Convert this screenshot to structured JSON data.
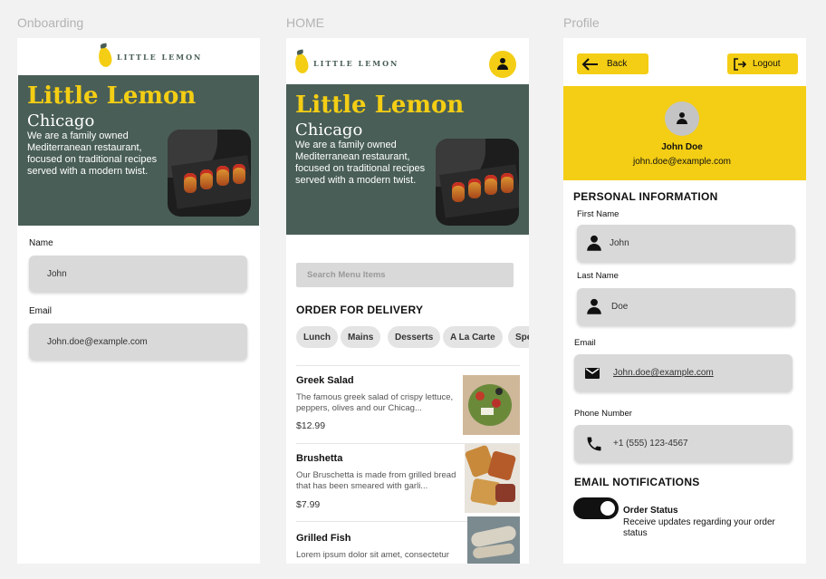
{
  "frames": {
    "onboarding_label": "Onboarding",
    "home_label": "HOME",
    "profile_label": "Profile"
  },
  "brand": {
    "logo_text": "LITTLE LEMON",
    "colors": {
      "primary_green": "#495e57",
      "primary_yellow": "#f4ce14",
      "field_gray": "#d9d9d9"
    }
  },
  "hero": {
    "title": "Little Lemon",
    "city": "Chicago",
    "description": "We are a family owned Mediterranean restaurant, focused on traditional recipes served with a modern twist."
  },
  "onboarding": {
    "name_label": "Name",
    "name_value": "John",
    "email_label": "Email",
    "email_value": "John.doe@example.com"
  },
  "home": {
    "search_placeholder": "Search Menu Items",
    "order_title": "ORDER FOR DELIVERY",
    "categories": [
      "Lunch",
      "Mains",
      "Desserts",
      "A La Carte",
      "Spe"
    ],
    "menu": [
      {
        "name": "Greek Salad",
        "description": "The famous greek salad of crispy lettuce, peppers, olives and our Chicag...",
        "price": "$12.99"
      },
      {
        "name": "Brushetta",
        "description": "Our Bruschetta is made from grilled bread that has been smeared with garli...",
        "price": "$7.99"
      },
      {
        "name": "Grilled Fish",
        "description": "Lorem ipsum dolor sit amet, consectetur adipiscing elit.",
        "price": ""
      }
    ]
  },
  "profile": {
    "back_label": "Back",
    "logout_label": "Logout",
    "user_name": "John Doe",
    "user_email": "john.doe@example.com",
    "personal_title": "PERSONAL INFORMATION",
    "first_name_label": "First Name",
    "first_name_value": "John",
    "last_name_label": "Last Name",
    "last_name_value": "Doe",
    "email_label": "Email",
    "email_value": "John.doe@example.com",
    "phone_label": "Phone Number",
    "phone_value": "+1 (555) 123-4567",
    "notifications_title": "EMAIL NOTIFICATIONS",
    "order_status_title": "Order Status",
    "order_status_desc": "Receive updates regarding your order status"
  },
  "icons": {
    "avatar": "person-icon",
    "back": "arrow-left-icon",
    "logout": "logout-icon",
    "email": "mail-icon",
    "phone": "phone-icon"
  }
}
